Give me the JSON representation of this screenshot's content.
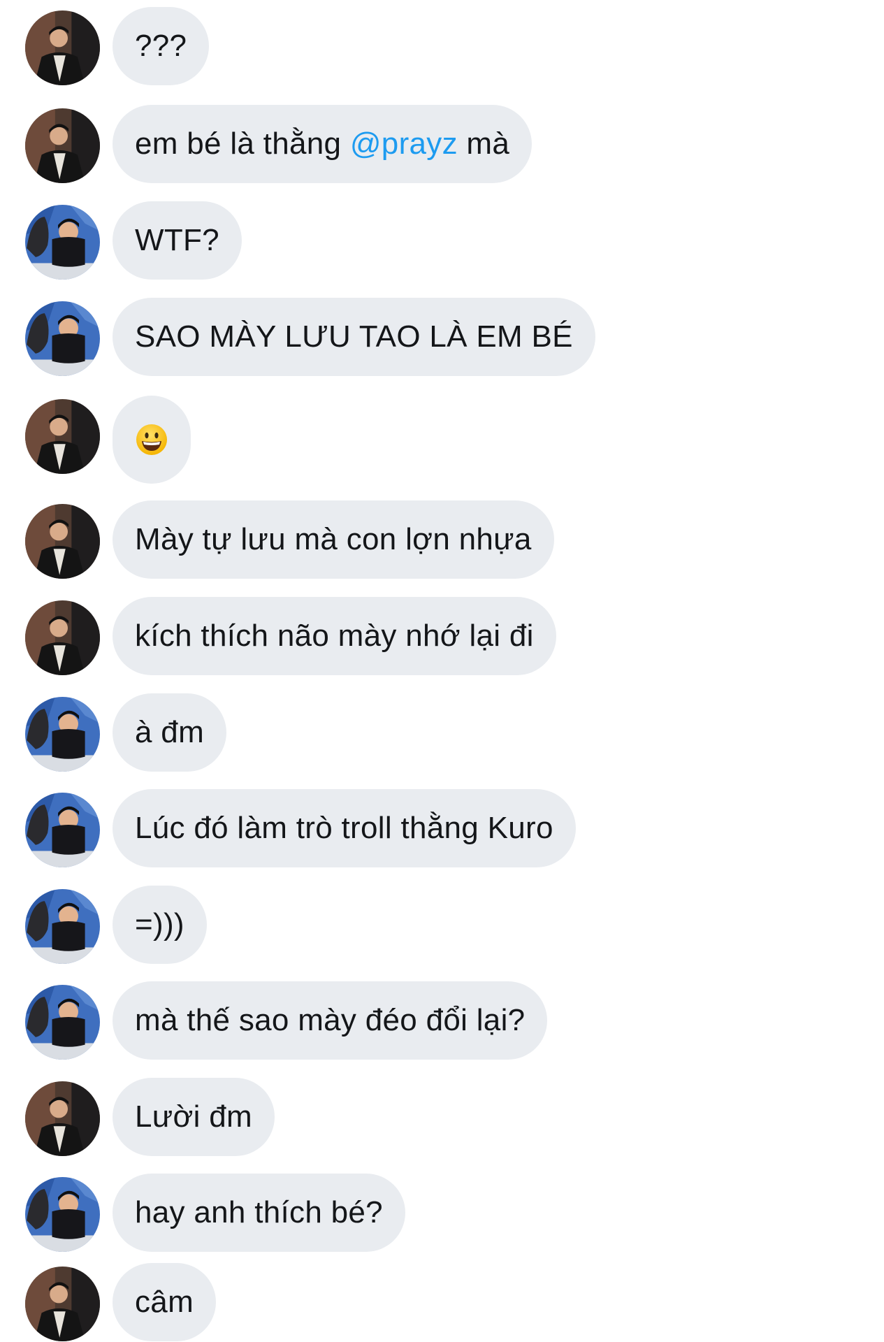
{
  "messages": [
    {
      "sender": "user-a",
      "text": "???"
    },
    {
      "sender": "user-a",
      "before": "em bé là thằng ",
      "mention": "@prayz",
      "after": " mà"
    },
    {
      "sender": "user-b",
      "text": "WTF?"
    },
    {
      "sender": "user-b",
      "text": "SAO MÀY LƯU TAO LÀ EM BÉ"
    },
    {
      "sender": "user-a",
      "emoji": "grinning-face-emoji"
    },
    {
      "sender": "user-a",
      "text": "Mày tự lưu mà con lợn nhựa"
    },
    {
      "sender": "user-a",
      "text": "kích thích não mày nhớ lại đi"
    },
    {
      "sender": "user-b",
      "text": "à đm"
    },
    {
      "sender": "user-b",
      "text": "Lúc đó làm trò troll thằng Kuro"
    },
    {
      "sender": "user-b",
      "text": "=)))"
    },
    {
      "sender": "user-b",
      "text": "mà thế sao mày đéo đổi lại?"
    },
    {
      "sender": "user-a",
      "text": "Lười đm"
    },
    {
      "sender": "user-b",
      "text": "hay anh thích bé?"
    },
    {
      "sender": "user-a",
      "text": "câm"
    }
  ],
  "colors": {
    "bubble": "#e9ecf0",
    "text": "#141619",
    "mention": "#1d9bf0",
    "background": "#ffffff"
  }
}
